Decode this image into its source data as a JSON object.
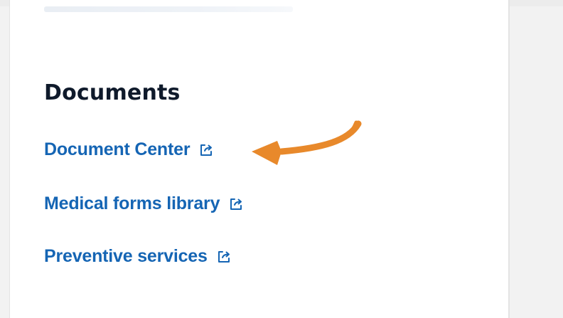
{
  "documents": {
    "title": "Documents",
    "links": [
      {
        "label": "Document Center",
        "icon": "external-link-icon"
      },
      {
        "label": "Medical forms library",
        "icon": "external-link-icon"
      },
      {
        "label": "Preventive services",
        "icon": "external-link-icon"
      }
    ]
  },
  "colors": {
    "link": "#1565b4",
    "title": "#0f1a2b",
    "arrow": "#e8892b",
    "card": "#ffffff",
    "page": "#f2f2f2"
  }
}
